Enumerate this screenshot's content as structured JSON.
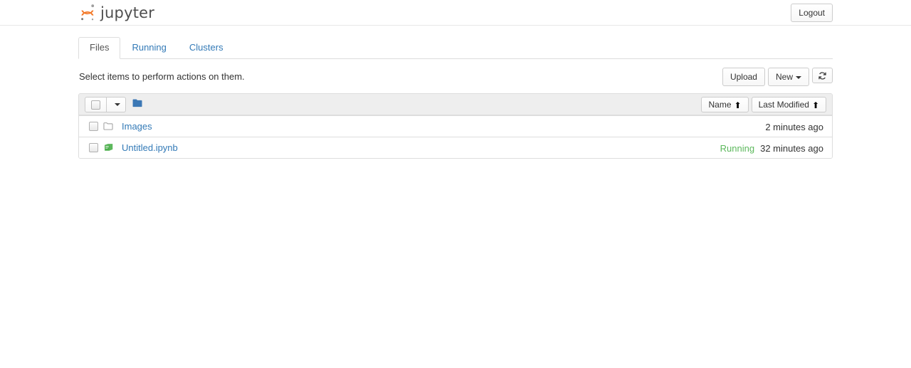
{
  "header": {
    "logo_text": "jupyter",
    "logo_icon": "jupyter-logo-icon",
    "logout_label": "Logout"
  },
  "tabs": [
    {
      "label": "Files",
      "active": true
    },
    {
      "label": "Running",
      "active": false
    },
    {
      "label": "Clusters",
      "active": false
    }
  ],
  "toolbar": {
    "message": "Select items to perform actions on them.",
    "upload_label": "Upload",
    "new_label": "New",
    "refresh_icon": "refresh-icon"
  },
  "list_header": {
    "select_all_checked": false,
    "dropdown_icon": "caret-down-icon",
    "breadcrumb_icon": "folder-open-icon",
    "sort_name_label": "Name",
    "sort_name_arrow": "⬆",
    "sort_modified_label": "Last Modified",
    "sort_modified_arrow": "⬆"
  },
  "items": [
    {
      "name": "Images",
      "icon": "folder-icon",
      "type": "directory",
      "running": "",
      "modified": "2 minutes ago",
      "checked": false
    },
    {
      "name": "Untitled.ipynb",
      "icon": "notebook-icon",
      "type": "notebook",
      "running": "Running",
      "modified": "32 minutes ago",
      "checked": false
    }
  ],
  "colors": {
    "link": "#337ab7",
    "running": "#5cb85c",
    "logo_orange": "#f37726",
    "folder_blue": "#3c78b5",
    "notebook_green": "#5cb85c",
    "panel_border": "#dddddd",
    "header_bg": "#eeeeee"
  }
}
